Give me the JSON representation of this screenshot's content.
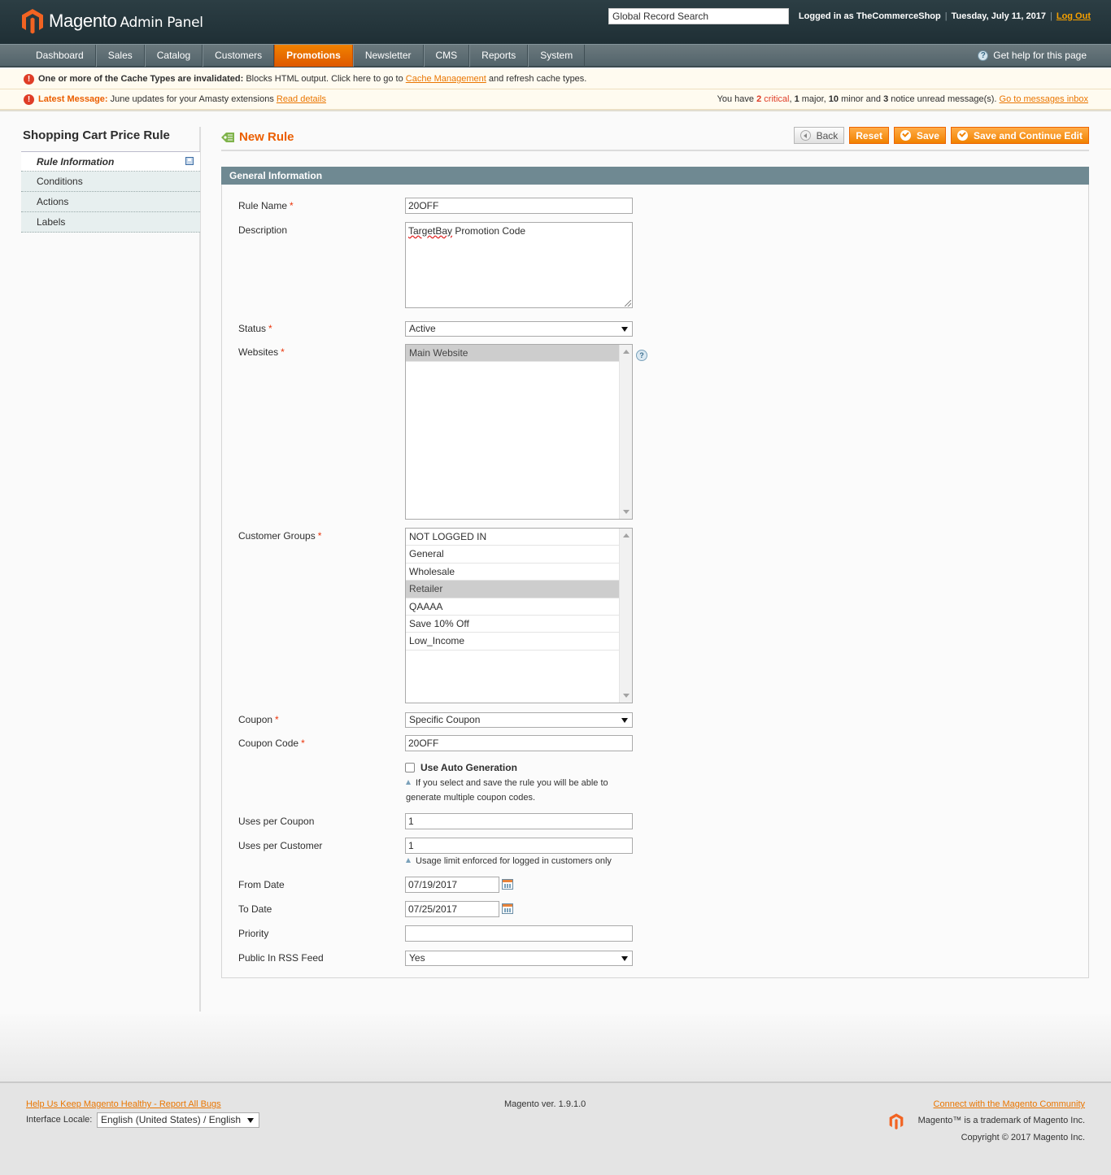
{
  "header": {
    "logo_name": "Magento",
    "logo_sub": "Admin Panel",
    "search_placeholder": "Global Record Search",
    "logged_in_text": "Logged in as TheCommerceShop",
    "date": "Tuesday, July 11, 2017",
    "logout_label": "Log Out"
  },
  "nav": {
    "items": [
      {
        "label": "Dashboard"
      },
      {
        "label": "Sales"
      },
      {
        "label": "Catalog"
      },
      {
        "label": "Customers"
      },
      {
        "label": "Promotions"
      },
      {
        "label": "Newsletter"
      },
      {
        "label": "CMS"
      },
      {
        "label": "Reports"
      },
      {
        "label": "System"
      }
    ],
    "active": "Promotions",
    "help_label": "Get help for this page"
  },
  "messages": {
    "cache_bold": "One or more of the Cache Types are invalidated:",
    "cache_text": " Blocks HTML output. Click here to go to ",
    "cache_link": "Cache Management",
    "cache_tail": " and refresh cache types.",
    "latest_bold": "Latest Message:",
    "latest_text": " June updates for your Amasty extensions ",
    "latest_link": "Read details",
    "inbox_prefix": "You have ",
    "critical_count": "2",
    "critical_label": " critical",
    "major_count": "1",
    "major_label": " major, ",
    "minor_count": "10",
    "minor_label": " minor and ",
    "notice_count": "3",
    "notice_label": " notice unread message(s). ",
    "inbox_link": "Go to messages inbox"
  },
  "sidebar": {
    "title": "Shopping Cart Price Rule",
    "tabs": [
      {
        "label": "Rule Information"
      },
      {
        "label": "Conditions"
      },
      {
        "label": "Actions"
      },
      {
        "label": "Labels"
      }
    ]
  },
  "content": {
    "title": "New Rule",
    "buttons": {
      "back": "Back",
      "reset": "Reset",
      "save": "Save",
      "save_continue": "Save and Continue Edit"
    },
    "fieldset_title": "General Information"
  },
  "form": {
    "rule_name": {
      "label": "Rule Name",
      "value": "20OFF"
    },
    "description": {
      "label": "Description",
      "value_misspelled": "TargetBay",
      "value_rest": " Promotion Code"
    },
    "status": {
      "label": "Status",
      "value": "Active"
    },
    "websites": {
      "label": "Websites",
      "options": [
        "Main Website"
      ],
      "selected": "Main Website"
    },
    "customer_groups": {
      "label": "Customer Groups",
      "options": [
        "NOT LOGGED IN",
        "General",
        "Wholesale",
        "Retailer",
        "QAAAA",
        "Save 10% Off",
        "Low_Income"
      ],
      "selected": "Retailer"
    },
    "coupon": {
      "label": "Coupon",
      "value": "Specific Coupon"
    },
    "coupon_code": {
      "label": "Coupon Code",
      "value": "20OFF"
    },
    "auto_generation": {
      "label": "Use Auto Generation",
      "checked": false,
      "note_line1": "If you select and save the rule you will be able to",
      "note_line2": "generate multiple coupon codes."
    },
    "uses_per_coupon": {
      "label": "Uses per Coupon",
      "value": "1"
    },
    "uses_per_customer": {
      "label": "Uses per Customer",
      "value": "1",
      "note": "Usage limit enforced for logged in customers only"
    },
    "from_date": {
      "label": "From Date",
      "value": "07/19/2017"
    },
    "to_date": {
      "label": "To Date",
      "value": "07/25/2017"
    },
    "priority": {
      "label": "Priority",
      "value": ""
    },
    "rss": {
      "label": "Public In RSS Feed",
      "value": "Yes"
    }
  },
  "footer": {
    "bugs_link": "Help Us Keep Magento Healthy - Report All Bugs",
    "locale_label": "Interface Locale:",
    "locale_value": "English (United States) / English",
    "version": "Magento ver. 1.9.1.0",
    "community_link": "Connect with the Magento Community",
    "trademark": "Magento™ is a trademark of Magento Inc.",
    "copyright": "Copyright © 2017 Magento Inc."
  },
  "colors": {
    "accent": "#eb5e00",
    "nav_active": "#f18200",
    "header_bg": "#2c3e44",
    "fieldset_header": "#6f8992"
  }
}
